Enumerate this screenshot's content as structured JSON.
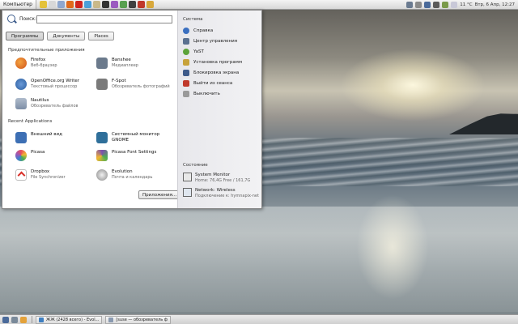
{
  "top_panel": {
    "computer_label": "Компьютер",
    "launchers": [
      {
        "icon": "edit-icon",
        "color": "#e4c23a"
      },
      {
        "icon": "note-icon",
        "color": "#d8d8d8"
      },
      {
        "icon": "calendar-icon",
        "color": "#8ea7cf"
      },
      {
        "icon": "firefox-icon",
        "color": "#e06a1c"
      },
      {
        "icon": "opera-icon",
        "color": "#d0241f"
      },
      {
        "icon": "mail-icon",
        "color": "#4aa0d9"
      },
      {
        "icon": "home-icon",
        "color": "#c9b98a"
      },
      {
        "icon": "terminal-icon",
        "color": "#333333"
      },
      {
        "icon": "music-icon",
        "color": "#9b5bc0"
      },
      {
        "icon": "chat-icon",
        "color": "#58a050"
      },
      {
        "icon": "video-icon",
        "color": "#404040"
      },
      {
        "icon": "pdf-icon",
        "color": "#c0392b"
      },
      {
        "icon": "image-icon",
        "color": "#d8a83b"
      }
    ],
    "temperature": "11 °C",
    "datetime": "Втр, 6 Апр, 12:27"
  },
  "menu": {
    "search_label": "Поиск:",
    "search_value": "",
    "tabs": [
      {
        "label": "Программы",
        "active": true
      },
      {
        "label": "Документы",
        "active": false
      },
      {
        "label": "Places",
        "active": false
      }
    ],
    "favorites_title": "Предпочтительные приложения",
    "favorites": [
      {
        "name": "Firefox",
        "desc": "Веб-браузер",
        "icon": "firefox-icon",
        "color": "#e06a1c"
      },
      {
        "name": "Banshee",
        "desc": "Медиаплеер",
        "icon": "banshee-icon",
        "color": "#6b7a8c"
      },
      {
        "name": "OpenOffice.org Writer",
        "desc": "Текстовый процессор",
        "icon": "writer-icon",
        "color": "#4a78b8"
      },
      {
        "name": "F-Spot",
        "desc": "Обозреватель фотографий",
        "icon": "fspot-icon",
        "color": "#7a7a7a"
      },
      {
        "name": "Nautilus",
        "desc": "Обозреватель файлов",
        "icon": "folder-icon",
        "color": "#8a9ab0"
      }
    ],
    "recent_title": "Recent Applications",
    "recent": [
      {
        "name": "Внешний вид",
        "desc": "",
        "icon": "appearance-icon",
        "color": "#3d6fb4"
      },
      {
        "name": "Системный монитор GNOME",
        "desc": "",
        "icon": "monitor-icon",
        "color": "#2f6f9a"
      },
      {
        "name": "Picasa",
        "desc": "",
        "icon": "picasa-icon",
        "color": "#d94f8a"
      },
      {
        "name": "Picasa Font Settings",
        "desc": "",
        "icon": "picasa-font-icon",
        "color": "#7d4fb0"
      },
      {
        "name": "Dropbox",
        "desc": "File Synchronizer",
        "icon": "dropbox-icon",
        "color": "#d9302a"
      },
      {
        "name": "Evolution",
        "desc": "Почта и календарь",
        "icon": "evolution-icon",
        "color": "#8a8a8a"
      }
    ],
    "apps_button": "Приложения...",
    "system_title": "Система",
    "system_items": [
      {
        "label": "Справка",
        "icon": "help-icon",
        "color": "#3a6fc0"
      },
      {
        "label": "Центр управления",
        "icon": "control-center-icon",
        "color": "#5a7090"
      },
      {
        "label": "YaST",
        "icon": "yast-icon",
        "color": "#5ca33a"
      },
      {
        "label": "Установка программ",
        "icon": "install-icon",
        "color": "#c7a23a"
      },
      {
        "label": "Блокировка экрана",
        "icon": "lock-icon",
        "color": "#3d5a8a"
      },
      {
        "label": "Выйти из сеанса",
        "icon": "logout-icon",
        "color": "#c0392b"
      },
      {
        "label": "Выключить",
        "icon": "shutdown-icon",
        "color": "#9a9a9a"
      }
    ],
    "status_title": "Состояние",
    "status_items": [
      {
        "name": "System Monitor",
        "desc": "Home: 76,4G Free / 161,7G",
        "icon": "hdd-icon"
      },
      {
        "name": "Network: Wireless",
        "desc": "Подключение к: hymnapix-net",
        "icon": "network-icon"
      }
    ]
  },
  "bottom_panel": {
    "tasks": [
      {
        "label": "ЖЖ (2428 всего) - Evol...",
        "icon": "mail-icon",
        "color": "#3f7fc0"
      },
      {
        "label": "[suse — обозреватель ф",
        "icon": "folder-icon",
        "color": "#8a9ab0"
      }
    ]
  }
}
